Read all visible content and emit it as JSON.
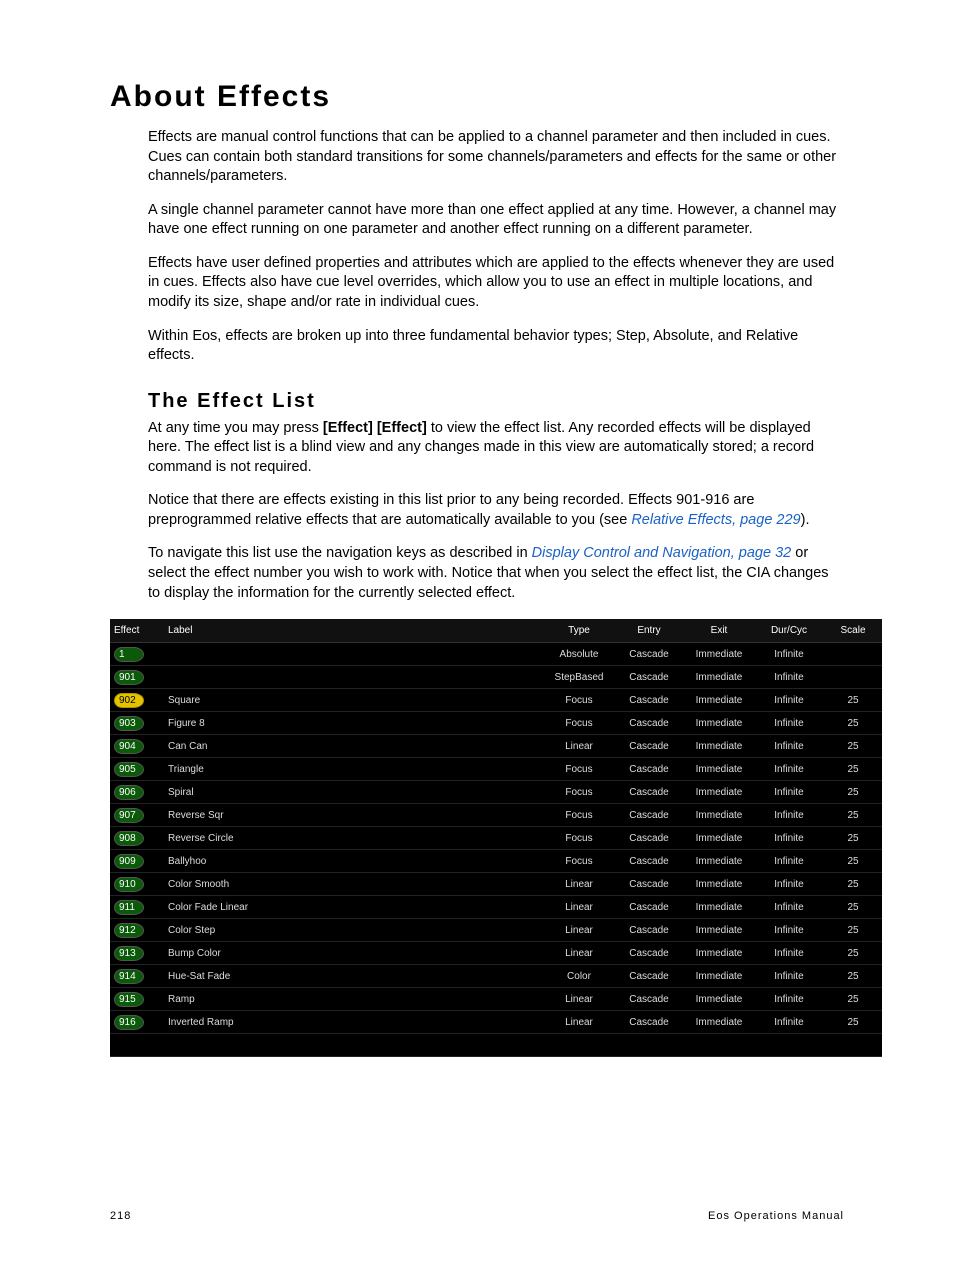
{
  "title": "About Effects",
  "paragraphs": {
    "p1": "Effects are manual control functions that can be applied to a channel parameter and then included in cues. Cues can contain both standard transitions for some channels/parameters and effects for the same or other channels/parameters.",
    "p2": "A single channel parameter cannot have more than one effect applied at any time. However, a channel may have one effect running on one parameter and another effect running on a different parameter.",
    "p3": "Effects have user defined properties and attributes which are applied to the effects whenever they are used in cues. Effects also have cue level overrides, which allow you to use an effect in multiple locations, and modify its size, shape and/or rate in individual cues.",
    "p4": "Within Eos, effects are broken up into three fundamental behavior types; Step, Absolute, and Relative effects."
  },
  "subhead": "The Effect List",
  "sub_paragraphs": {
    "s1a": "At any time you may press ",
    "s1b": "[Effect] [Effect]",
    "s1c": " to view the effect list. Any recorded effects will be displayed here. The effect list is a blind view and any changes made in this view are automatically stored; a record command is not required.",
    "s2a": "Notice that there are effects existing in this list prior to any being recorded. Effects 901-916 are preprogrammed relative effects that are automatically available to you (see ",
    "s2_link": "Relative Effects, page 229",
    "s2b": ").",
    "s3a": "To navigate this list use the navigation keys as described in ",
    "s3_link": "Display Control and Navigation, page 32",
    "s3b": " or select the effect number you wish to work with. Notice that when you select the effect list, the CIA changes to display the information for the currently selected effect."
  },
  "table": {
    "headers": {
      "effect": "Effect",
      "label": "Label",
      "type": "Type",
      "entry": "Entry",
      "exit": "Exit",
      "dur": "Dur/Cyc",
      "scale": "Scale"
    },
    "rows": [
      {
        "id": "1",
        "chip": "green",
        "label": "",
        "type": "Absolute",
        "entry": "Cascade",
        "exit": "Immediate",
        "dur": "Infinite",
        "scale": ""
      },
      {
        "id": "901",
        "chip": "green",
        "label": "",
        "type": "StepBased",
        "entry": "Cascade",
        "exit": "Immediate",
        "dur": "Infinite",
        "scale": ""
      },
      {
        "id": "902",
        "chip": "yellow",
        "label": "Square",
        "type": "Focus",
        "entry": "Cascade",
        "exit": "Immediate",
        "dur": "Infinite",
        "scale": "25"
      },
      {
        "id": "903",
        "chip": "green",
        "label": "Figure 8",
        "type": "Focus",
        "entry": "Cascade",
        "exit": "Immediate",
        "dur": "Infinite",
        "scale": "25"
      },
      {
        "id": "904",
        "chip": "green",
        "label": "Can Can",
        "type": "Linear",
        "entry": "Cascade",
        "exit": "Immediate",
        "dur": "Infinite",
        "scale": "25"
      },
      {
        "id": "905",
        "chip": "green",
        "label": "Triangle",
        "type": "Focus",
        "entry": "Cascade",
        "exit": "Immediate",
        "dur": "Infinite",
        "scale": "25"
      },
      {
        "id": "906",
        "chip": "green",
        "label": "Spiral",
        "type": "Focus",
        "entry": "Cascade",
        "exit": "Immediate",
        "dur": "Infinite",
        "scale": "25"
      },
      {
        "id": "907",
        "chip": "green",
        "label": "Reverse Sqr",
        "type": "Focus",
        "entry": "Cascade",
        "exit": "Immediate",
        "dur": "Infinite",
        "scale": "25"
      },
      {
        "id": "908",
        "chip": "green",
        "label": "Reverse Circle",
        "type": "Focus",
        "entry": "Cascade",
        "exit": "Immediate",
        "dur": "Infinite",
        "scale": "25"
      },
      {
        "id": "909",
        "chip": "green",
        "label": "Ballyhoo",
        "type": "Focus",
        "entry": "Cascade",
        "exit": "Immediate",
        "dur": "Infinite",
        "scale": "25"
      },
      {
        "id": "910",
        "chip": "green",
        "label": "Color Smooth",
        "type": "Linear",
        "entry": "Cascade",
        "exit": "Immediate",
        "dur": "Infinite",
        "scale": "25"
      },
      {
        "id": "911",
        "chip": "green",
        "label": "Color Fade Linear",
        "type": "Linear",
        "entry": "Cascade",
        "exit": "Immediate",
        "dur": "Infinite",
        "scale": "25"
      },
      {
        "id": "912",
        "chip": "green",
        "label": "Color Step",
        "type": "Linear",
        "entry": "Cascade",
        "exit": "Immediate",
        "dur": "Infinite",
        "scale": "25"
      },
      {
        "id": "913",
        "chip": "green",
        "label": "Bump Color",
        "type": "Linear",
        "entry": "Cascade",
        "exit": "Immediate",
        "dur": "Infinite",
        "scale": "25"
      },
      {
        "id": "914",
        "chip": "green",
        "label": "Hue-Sat Fade",
        "type": "Color",
        "entry": "Cascade",
        "exit": "Immediate",
        "dur": "Infinite",
        "scale": "25"
      },
      {
        "id": "915",
        "chip": "green",
        "label": "Ramp",
        "type": "Linear",
        "entry": "Cascade",
        "exit": "Immediate",
        "dur": "Infinite",
        "scale": "25"
      },
      {
        "id": "916",
        "chip": "green",
        "label": "Inverted Ramp",
        "type": "Linear",
        "entry": "Cascade",
        "exit": "Immediate",
        "dur": "Infinite",
        "scale": "25"
      }
    ]
  },
  "footer": {
    "page": "218",
    "doc": "Eos Operations Manual"
  }
}
